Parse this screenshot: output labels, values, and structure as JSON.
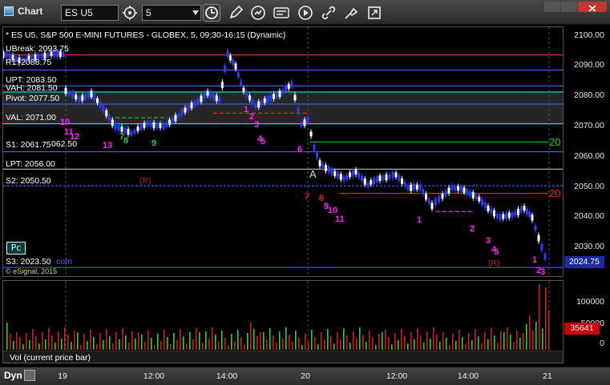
{
  "toolbar": {
    "title": "Chart",
    "symbol": "ES U5",
    "interval": "5",
    "icons": [
      "app-icon",
      "symbol-lookup-icon",
      "interval-clock-icon",
      "draw-pencil-icon",
      "refresh-icon",
      "toolbar-app-icon",
      "play-icon",
      "link-icon",
      "palette-icon",
      "maximize-icon"
    ]
  },
  "chart": {
    "header": "* ES U5, S&P 500 E-MINI FUTURES - GLOBEX, 5, 09:30-16:15 (Dynamic)",
    "copyright": "© eSignal, 2015",
    "pc_label": "Pc",
    "price_ticks": [
      "2100.00",
      "2090.00",
      "2080.00",
      "2070.00",
      "2060.00",
      "2050.00",
      "2040.00",
      "2030.00"
    ],
    "last_price": "2024.75",
    "level_labels": {
      "ubreak": "UBreak: 2093.75",
      "r1": "R1: 2088.75",
      "upt": "UPT: 2083.50",
      "vah": "VAH: 2081.50",
      "pivot": "Pivot: 2077.50",
      "val": "VAL: 2071.00",
      "s1": "S1: 2061.75",
      "s1_tail": "062.50",
      "lpt": "LPT: 2056.00",
      "s2": "S2: 2050.50",
      "s3": "S3: 2023.50",
      "s3_tail": "com"
    },
    "markers": {
      "r_mark": "(R)",
      "a_mark": "A",
      "twenty": "20"
    },
    "seq_red": [
      "7",
      "8",
      "9",
      "10",
      "11"
    ],
    "seq_magenta_1": [
      "10",
      "11",
      "12",
      "13"
    ],
    "seq_magenta_2": [
      "1",
      "2",
      "3",
      "4",
      "5"
    ],
    "seq_magenta_3": [
      "1",
      "2",
      "3",
      "4",
      "5",
      "6",
      "7"
    ],
    "seq_magenta_4": [
      "6"
    ],
    "seq_magenta_5": [
      "1",
      "2",
      "3"
    ],
    "seq_green": [
      "7",
      "8",
      "9"
    ],
    "colors": {
      "up_bar": "#ffffff",
      "down_bar": "#2b3cff",
      "ubreak": "#ff2020",
      "upt_vah_pivot": "#3b5cff",
      "val_s": "#00e5e5",
      "green_line": "#22cc22",
      "seq_red": "#ff1a1a",
      "seq_magenta": "#ff22ff",
      "seq_green": "#22cc55"
    }
  },
  "volume": {
    "label": "Vol (current price bar)",
    "ticks": [
      "100000",
      "50000",
      "0"
    ],
    "last": "35641"
  },
  "time_axis": {
    "dyn_label": "Dyn",
    "labels": [
      "19",
      "12:00",
      "14:00",
      "20",
      "12:00",
      "14:00",
      "21"
    ]
  }
}
